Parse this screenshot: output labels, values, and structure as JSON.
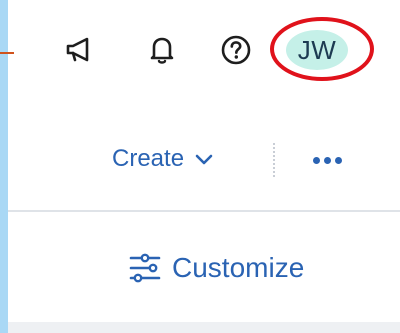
{
  "header": {
    "icons": [
      "megaphone-icon",
      "bell-icon",
      "help-icon"
    ],
    "avatar_initials": "JW",
    "avatar_color": "#c5f0e8",
    "highlight_color": "#e0121b"
  },
  "actions": {
    "create_label": "Create",
    "create_icon": "chevron-down-icon",
    "more_icon": "more-horizontal-icon"
  },
  "customize": {
    "label": "Customize",
    "icon": "sliders-icon"
  },
  "colors": {
    "accent": "#2a63b3",
    "background_frame": "#a9d8f5"
  }
}
